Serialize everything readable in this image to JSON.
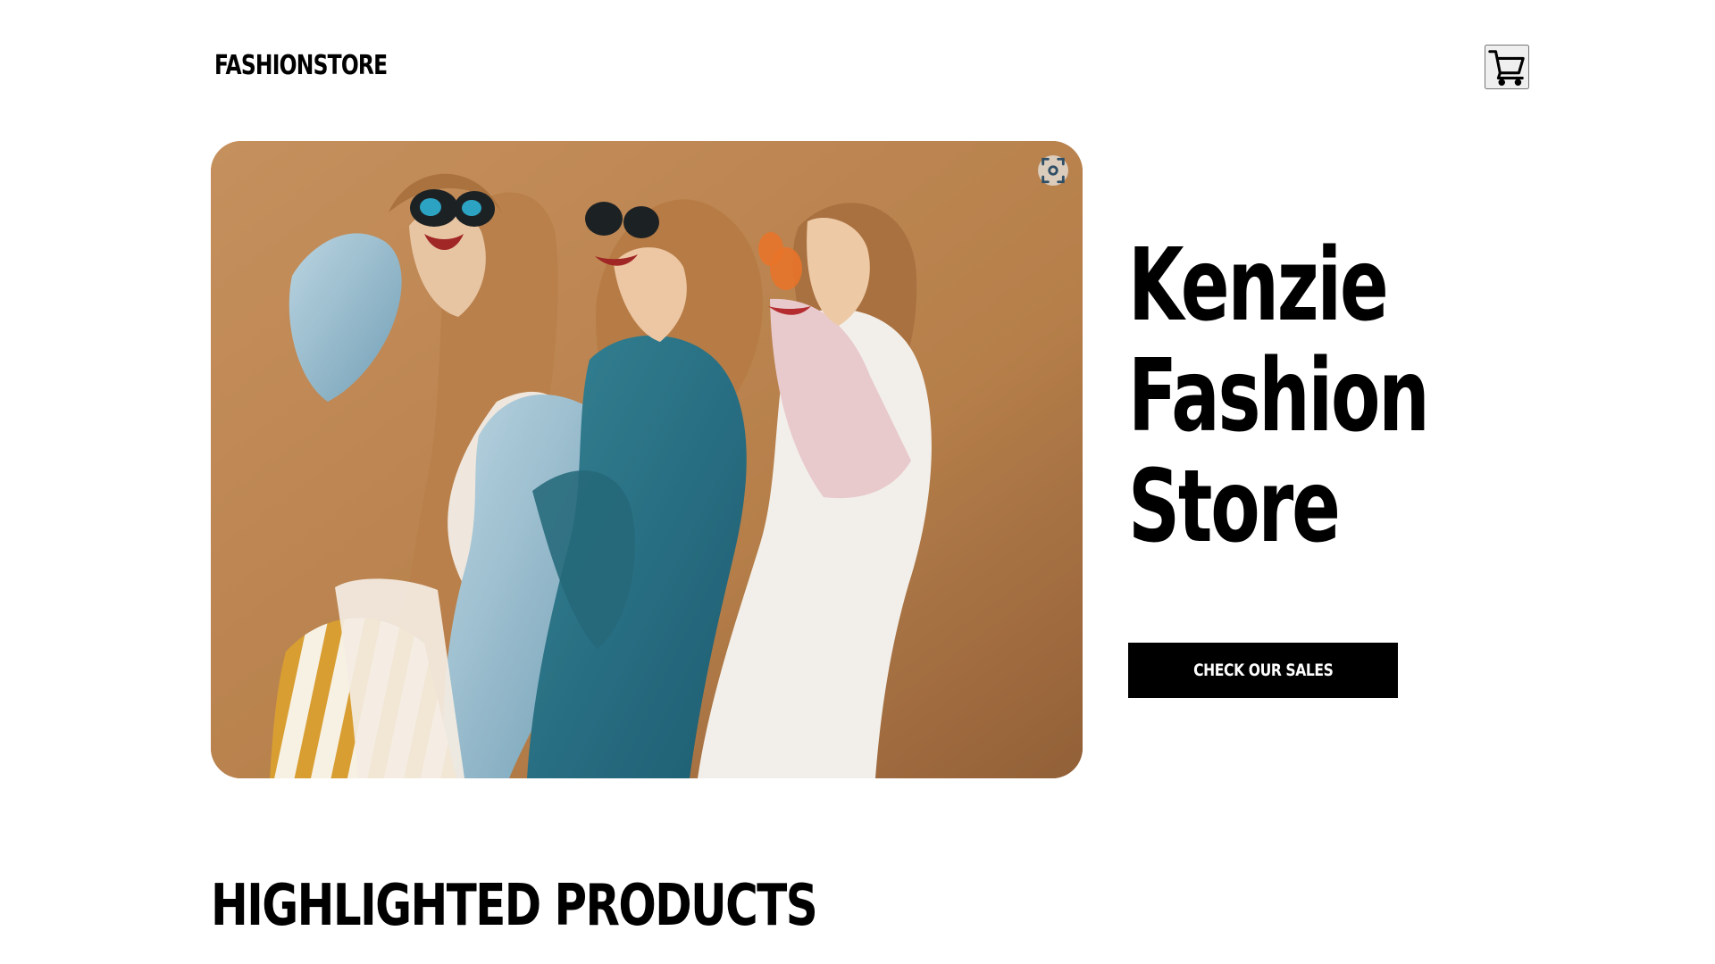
{
  "header": {
    "logo_text": "FASHIONSTORE",
    "cart_icon": "shopping-cart-icon"
  },
  "hero": {
    "image_subject": "three smiling women wearing sunglasses",
    "lens_icon": "lens-search-icon",
    "title": "Kenzie\nFashion\nStore",
    "cta_label": "CHECK OUR SALES"
  },
  "sections": {
    "highlighted_title": "HIGHLIGHTED PRODUCTS"
  },
  "colors": {
    "background": "#ffffff",
    "text": "#000000",
    "button_background": "#000000",
    "button_text": "#ffffff",
    "hero_background": "#b57c45"
  }
}
